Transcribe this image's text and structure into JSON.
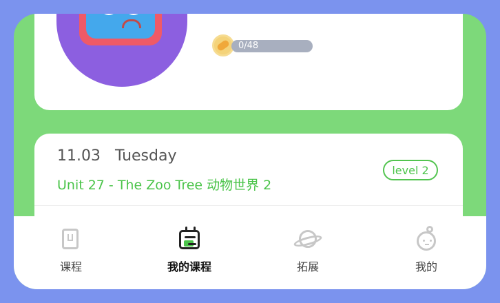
{
  "profile": {
    "coin_count": "0/48"
  },
  "lesson": {
    "date": "11.03",
    "weekday": "Tuesday",
    "title": "Unit 27 - The Zoo Tree 动物世界 2",
    "level": "level 2"
  },
  "tabbar": {
    "items": [
      {
        "label": "课程",
        "icon": "course-icon"
      },
      {
        "label": "我的课程",
        "icon": "my-course-icon"
      },
      {
        "label": "拓展",
        "icon": "planet-icon"
      },
      {
        "label": "我的",
        "icon": "profile-icon"
      }
    ]
  },
  "colors": {
    "background": "#7dd97a",
    "frame": "#7b93ee",
    "accent_green": "#4bc44a",
    "progress_bg": "#a8afbf"
  }
}
